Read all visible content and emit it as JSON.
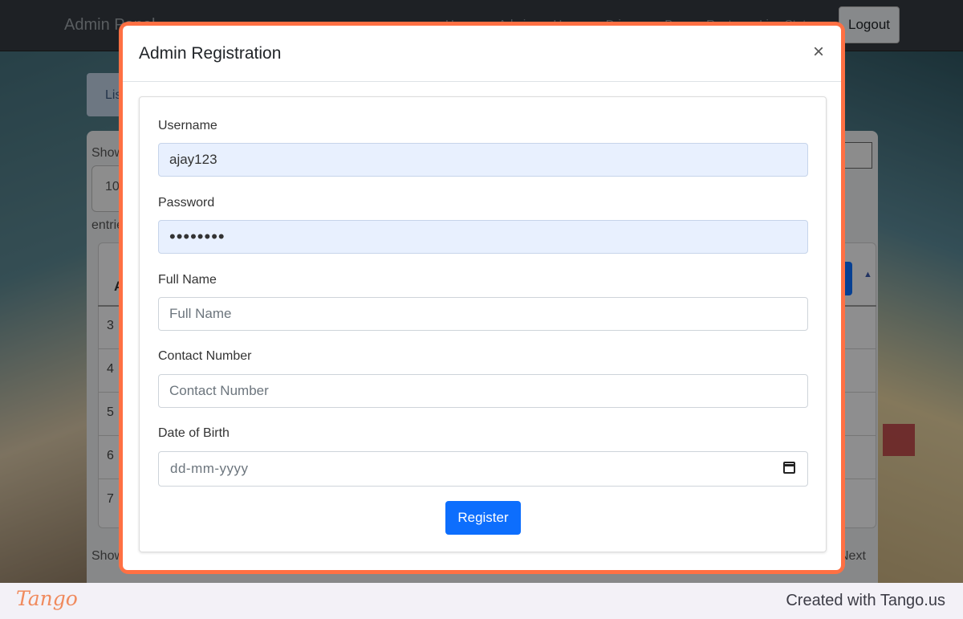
{
  "background_app": {
    "brand": "Admin Panel",
    "nav_items": [
      "Home",
      "Admin",
      "Users",
      "Drivers",
      "Bus",
      "Route",
      "Live Stat"
    ],
    "logout_label": "Logout",
    "list_button_label": "Lis",
    "show_top_label": "Show",
    "entries_select_value": "10",
    "entries_label": "entries",
    "table_header_first": "A",
    "row_numbers": [
      "3",
      "4",
      "5",
      "6",
      "7"
    ],
    "show_bottom_label": "Show",
    "next_label": "Next"
  },
  "modal": {
    "title": "Admin Registration",
    "close_symbol": "×",
    "fields": {
      "username": {
        "label": "Username",
        "value": "ajay123",
        "placeholder": "Username"
      },
      "password": {
        "label": "Password",
        "value": "••••••••",
        "placeholder": "Password"
      },
      "full_name": {
        "label": "Full Name",
        "value": "",
        "placeholder": "Full Name"
      },
      "contact": {
        "label": "Contact Number",
        "value": "",
        "placeholder": "Contact Number"
      },
      "dob": {
        "label": "Date of Birth",
        "value": "",
        "placeholder": "dd-mm-yyyy",
        "icon": "calendar-icon"
      }
    },
    "submit_label": "Register"
  },
  "footer": {
    "logo_text": "Tango",
    "caption": "Created with Tango.us"
  },
  "colors": {
    "highlight_outline": "#ff7043",
    "primary": "#0d6efd",
    "autofill_bg": "#e8f0fe",
    "navbar": "#343a40"
  }
}
